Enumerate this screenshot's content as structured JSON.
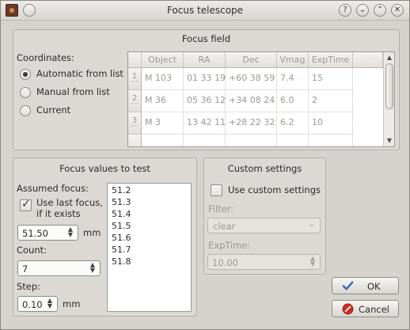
{
  "window": {
    "title": "Focus telescope",
    "controls": [
      "help",
      "minimize",
      "maximize",
      "close"
    ]
  },
  "focus_field": {
    "title": "Focus field",
    "coordinates_label": "Coordinates:",
    "options": [
      {
        "label": "Automatic from list",
        "checked": true
      },
      {
        "label": "Manual from list",
        "checked": false
      },
      {
        "label": "Current",
        "checked": false
      }
    ],
    "table": {
      "headers": [
        "Object",
        "RA",
        "Dec",
        "Vmag",
        "ExpTime"
      ],
      "rows": [
        {
          "num": "1",
          "cells": [
            "M 103",
            "01 33 19",
            "+60 38 59",
            "7.4",
            "15"
          ]
        },
        {
          "num": "2",
          "cells": [
            "M 36",
            "05 36 12",
            "+34 08 24",
            "6.0",
            "2"
          ]
        },
        {
          "num": "3",
          "cells": [
            "M 3",
            "13 42 11",
            "+28 22 32",
            "6.2",
            "10"
          ]
        }
      ]
    }
  },
  "focus_values": {
    "title": "Focus values to test",
    "assumed_label": "Assumed focus:",
    "use_last_label_1": "Use last focus,",
    "use_last_label_2": "if it exists",
    "use_last_checked": true,
    "assumed_value": "51.50",
    "assumed_unit": "mm",
    "count_label": "Count:",
    "count_value": "7",
    "step_label": "Step:",
    "step_value": "0.10",
    "step_unit": "mm",
    "values": [
      "51.2",
      "51.3",
      "51.4",
      "51.5",
      "51.6",
      "51.7",
      "51.8"
    ]
  },
  "custom_settings": {
    "title": "Custom settings",
    "use_custom_label": "Use custom settings",
    "use_custom_checked": false,
    "filter_label": "Filter:",
    "filter_value": "clear",
    "exptime_label": "ExpTime:",
    "exptime_value": "10.00"
  },
  "buttons": {
    "ok": "OK",
    "cancel": "Cancel"
  },
  "colors": {
    "ok_icon": "#3a64b8",
    "cancel_icon": "#cc2b22"
  }
}
